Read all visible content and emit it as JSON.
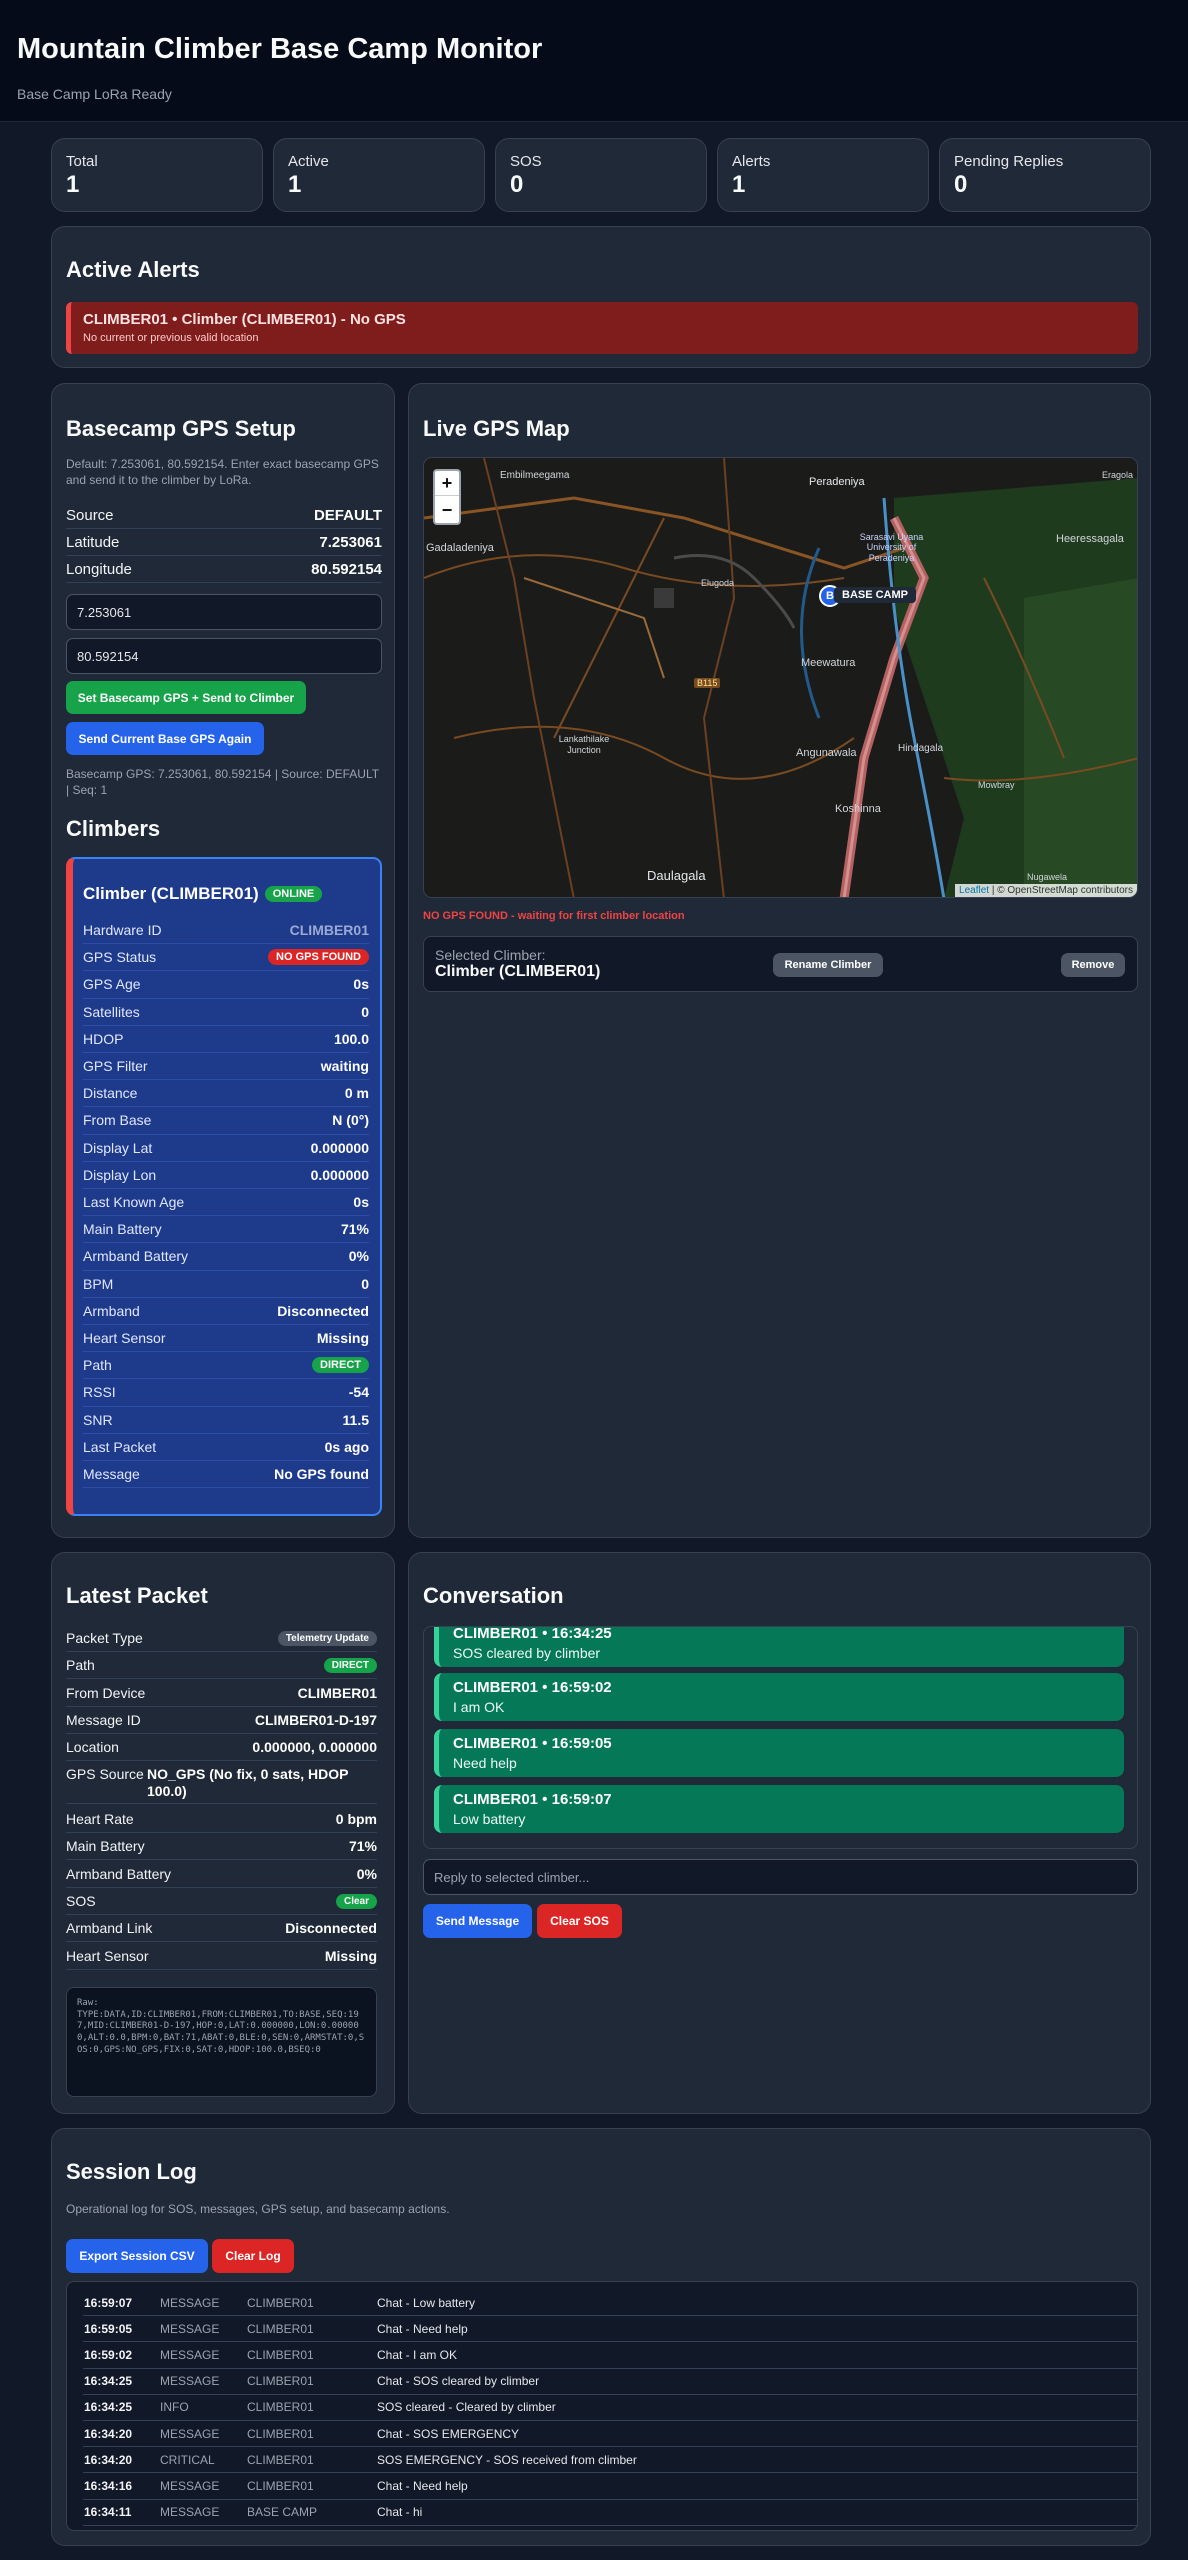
{
  "header": {
    "title": "Mountain Climber Base Camp Monitor",
    "subtitle": "Base Camp LoRa Ready"
  },
  "stats": [
    {
      "label": "Total",
      "value": "1"
    },
    {
      "label": "Active",
      "value": "1"
    },
    {
      "label": "SOS",
      "value": "0"
    },
    {
      "label": "Alerts",
      "value": "1"
    },
    {
      "label": "Pending Replies",
      "value": "0"
    }
  ],
  "alerts": {
    "title": "Active Alerts",
    "items": [
      {
        "title": "CLIMBER01 • Climber (CLIMBER01) - No GPS",
        "detail": "No current or previous valid location"
      }
    ]
  },
  "gps_setup": {
    "title": "Basecamp GPS Setup",
    "note": "Default: 7.253061, 80.592154. Enter exact basecamp GPS and send it to the climber by LoRa.",
    "rows": [
      {
        "k": "Source",
        "v": "DEFAULT"
      },
      {
        "k": "Latitude",
        "v": "7.253061"
      },
      {
        "k": "Longitude",
        "v": "80.592154"
      }
    ],
    "lat_input": "7.253061",
    "lon_input": "80.592154",
    "set_button": "Set Basecamp GPS + Send to Climber",
    "resend_button": "Send Current Base GPS Again",
    "status": "Basecamp GPS: 7.253061, 80.592154 | Source: DEFAULT | Seq: 1"
  },
  "climbers": {
    "title": "Climbers",
    "card": {
      "name": "Climber (CLIMBER01)",
      "online": "ONLINE",
      "rows": [
        {
          "k": "Hardware ID",
          "v": "CLIMBER01"
        },
        {
          "k": "GPS Status",
          "v": "NO GPS FOUND"
        },
        {
          "k": "GPS Age",
          "v": "0s"
        },
        {
          "k": "Satellites",
          "v": "0"
        },
        {
          "k": "HDOP",
          "v": "100.0"
        },
        {
          "k": "GPS Filter",
          "v": "waiting"
        },
        {
          "k": "Distance",
          "v": "0 m"
        },
        {
          "k": "From Base",
          "v": "N (0°)"
        },
        {
          "k": "Display Lat",
          "v": "0.000000"
        },
        {
          "k": "Display Lon",
          "v": "0.000000"
        },
        {
          "k": "Last Known Age",
          "v": "0s"
        },
        {
          "k": "Main Battery",
          "v": "71%"
        },
        {
          "k": "Armband Battery",
          "v": "0%"
        },
        {
          "k": "BPM",
          "v": "0"
        },
        {
          "k": "Armband",
          "v": "Disconnected"
        },
        {
          "k": "Heart Sensor",
          "v": "Missing"
        },
        {
          "k": "Path",
          "v": "DIRECT"
        },
        {
          "k": "RSSI",
          "v": "-54"
        },
        {
          "k": "SNR",
          "v": "11.5"
        },
        {
          "k": "Last Packet",
          "v": "0s ago"
        },
        {
          "k": "Message",
          "v": "No GPS found"
        }
      ]
    }
  },
  "map": {
    "title": "Live GPS Map",
    "zoom_in": "+",
    "zoom_out": "−",
    "marker_label": "BASE CAMP",
    "marker_letter": "B",
    "attribution_leaflet": "Leaflet",
    "attribution_rest": "| © OpenStreetMap contributors",
    "places": {
      "embilmeegama": "Embilmeegama",
      "peradeniya": "Peradeniya",
      "eragola": "Eragola",
      "gadaladeniya": "Gadaladeniya",
      "heeressagala": "Heeressagala",
      "elugoda": "Elugoda",
      "university": "Sarasavi Uyana University of Peradeniya",
      "meewatura": "Meewatura",
      "lankathilake": "Lankathilake Junction",
      "angunawala": "Angunawala",
      "hindagala": "Hindagala",
      "mowbray": "Mowbray",
      "koshinna": "Koshinna",
      "daulagala": "Daulagala",
      "road_b115": "B115",
      "nugawela": "Nugawela"
    },
    "status": "NO GPS FOUND - waiting for first climber location",
    "selected_label": "Selected Climber:",
    "selected_name": "Climber (CLIMBER01)",
    "rename_button": "Rename Climber",
    "remove_button": "Remove"
  },
  "latest_packet": {
    "title": "Latest Packet",
    "rows": [
      {
        "k": "Packet Type",
        "v": "Telemetry Update"
      },
      {
        "k": "Path",
        "v": "DIRECT"
      },
      {
        "k": "From Device",
        "v": "CLIMBER01"
      },
      {
        "k": "Message ID",
        "v": "CLIMBER01-D-197"
      },
      {
        "k": "Location",
        "v": "0.000000, 0.000000"
      },
      {
        "k": "GPS Source",
        "v": "NO_GPS (No fix, 0 sats, HDOP 100.0)"
      },
      {
        "k": "Heart Rate",
        "v": "0 bpm"
      },
      {
        "k": "Main Battery",
        "v": "71%"
      },
      {
        "k": "Armband Battery",
        "v": "0%"
      },
      {
        "k": "SOS",
        "v": "Clear"
      },
      {
        "k": "Armband Link",
        "v": "Disconnected"
      },
      {
        "k": "Heart Sensor",
        "v": "Missing"
      }
    ],
    "raw": "Raw:\nTYPE:DATA,ID:CLIMBER01,FROM:CLIMBER01,TO:BASE,SEQ:197,MID:CLIMBER01-D-197,HOP:0,LAT:0.000000,LON:0.000000,ALT:0.0,BPM:0,BAT:71,ABAT:0,BLE:0,SEN:0,ARMSTAT:0,SOS:0,GPS:NO_GPS,FIX:0,SAT:0,HDOP:100.0,BSEQ:0"
  },
  "conversation": {
    "title": "Conversation",
    "messages": [
      {
        "head": "CLIMBER01 • 16:34:25",
        "body": "SOS cleared by climber"
      },
      {
        "head": "CLIMBER01 • 16:59:02",
        "body": "I am OK"
      },
      {
        "head": "CLIMBER01 • 16:59:05",
        "body": "Need help"
      },
      {
        "head": "CLIMBER01 • 16:59:07",
        "body": "Low battery"
      }
    ],
    "reply_placeholder": "Reply to selected climber...",
    "send_button": "Send Message",
    "clear_sos_button": "Clear SOS"
  },
  "session_log": {
    "title": "Session Log",
    "note": "Operational log for SOS, messages, GPS setup, and basecamp actions.",
    "export_button": "Export Session CSV",
    "clear_button": "Clear Log",
    "rows": [
      {
        "time": "16:59:07",
        "type": "MESSAGE",
        "src": "CLIMBER01",
        "text": "Chat - Low battery"
      },
      {
        "time": "16:59:05",
        "type": "MESSAGE",
        "src": "CLIMBER01",
        "text": "Chat - Need help"
      },
      {
        "time": "16:59:02",
        "type": "MESSAGE",
        "src": "CLIMBER01",
        "text": "Chat - I am OK"
      },
      {
        "time": "16:34:25",
        "type": "MESSAGE",
        "src": "CLIMBER01",
        "text": "Chat - SOS cleared by climber"
      },
      {
        "time": "16:34:25",
        "type": "INFO",
        "src": "CLIMBER01",
        "text": "SOS cleared - Cleared by climber"
      },
      {
        "time": "16:34:20",
        "type": "MESSAGE",
        "src": "CLIMBER01",
        "text": "Chat - SOS EMERGENCY"
      },
      {
        "time": "16:34:20",
        "type": "CRITICAL",
        "src": "CLIMBER01",
        "text": "SOS EMERGENCY - SOS received from climber"
      },
      {
        "time": "16:34:16",
        "type": "MESSAGE",
        "src": "CLIMBER01",
        "text": "Chat - Need help"
      },
      {
        "time": "16:34:11",
        "type": "MESSAGE",
        "src": "BASE CAMP",
        "text": "Chat - hi"
      }
    ]
  },
  "colors": {
    "online": "#16a34a",
    "no_gps": "#dc2626",
    "direct": "#16a34a",
    "chat": "#047857",
    "alert": "#7f1d1d"
  }
}
